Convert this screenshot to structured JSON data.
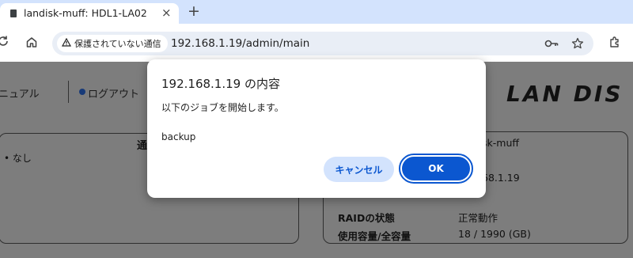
{
  "browser": {
    "tab_title": "landisk-muff: HDL1-LA02",
    "tab_close": "×",
    "new_tab": "+",
    "security_label": "保護されていない通信",
    "url": "192.168.1.19/admin/main"
  },
  "nav": {
    "manual_label": "ニュアル",
    "logout_label": "ログアウト",
    "logo_text": "LAN DIS"
  },
  "left_panel": {
    "title_fragment": "通",
    "items": [
      "なし"
    ]
  },
  "right_panel": {
    "name_value": "sk-muff",
    "ip_value": "68.1.19",
    "raid_label": "RAIDの状態",
    "raid_value": "正常動作",
    "capacity_label": "使用容量/全容量",
    "capacity_value": "18 / 1990 (GB)"
  },
  "dialog": {
    "title": "192.168.1.19 の内容",
    "message": "以下のジョブを開始します。",
    "job_name": "backup",
    "cancel_label": "キャンセル",
    "ok_label": "OK"
  }
}
